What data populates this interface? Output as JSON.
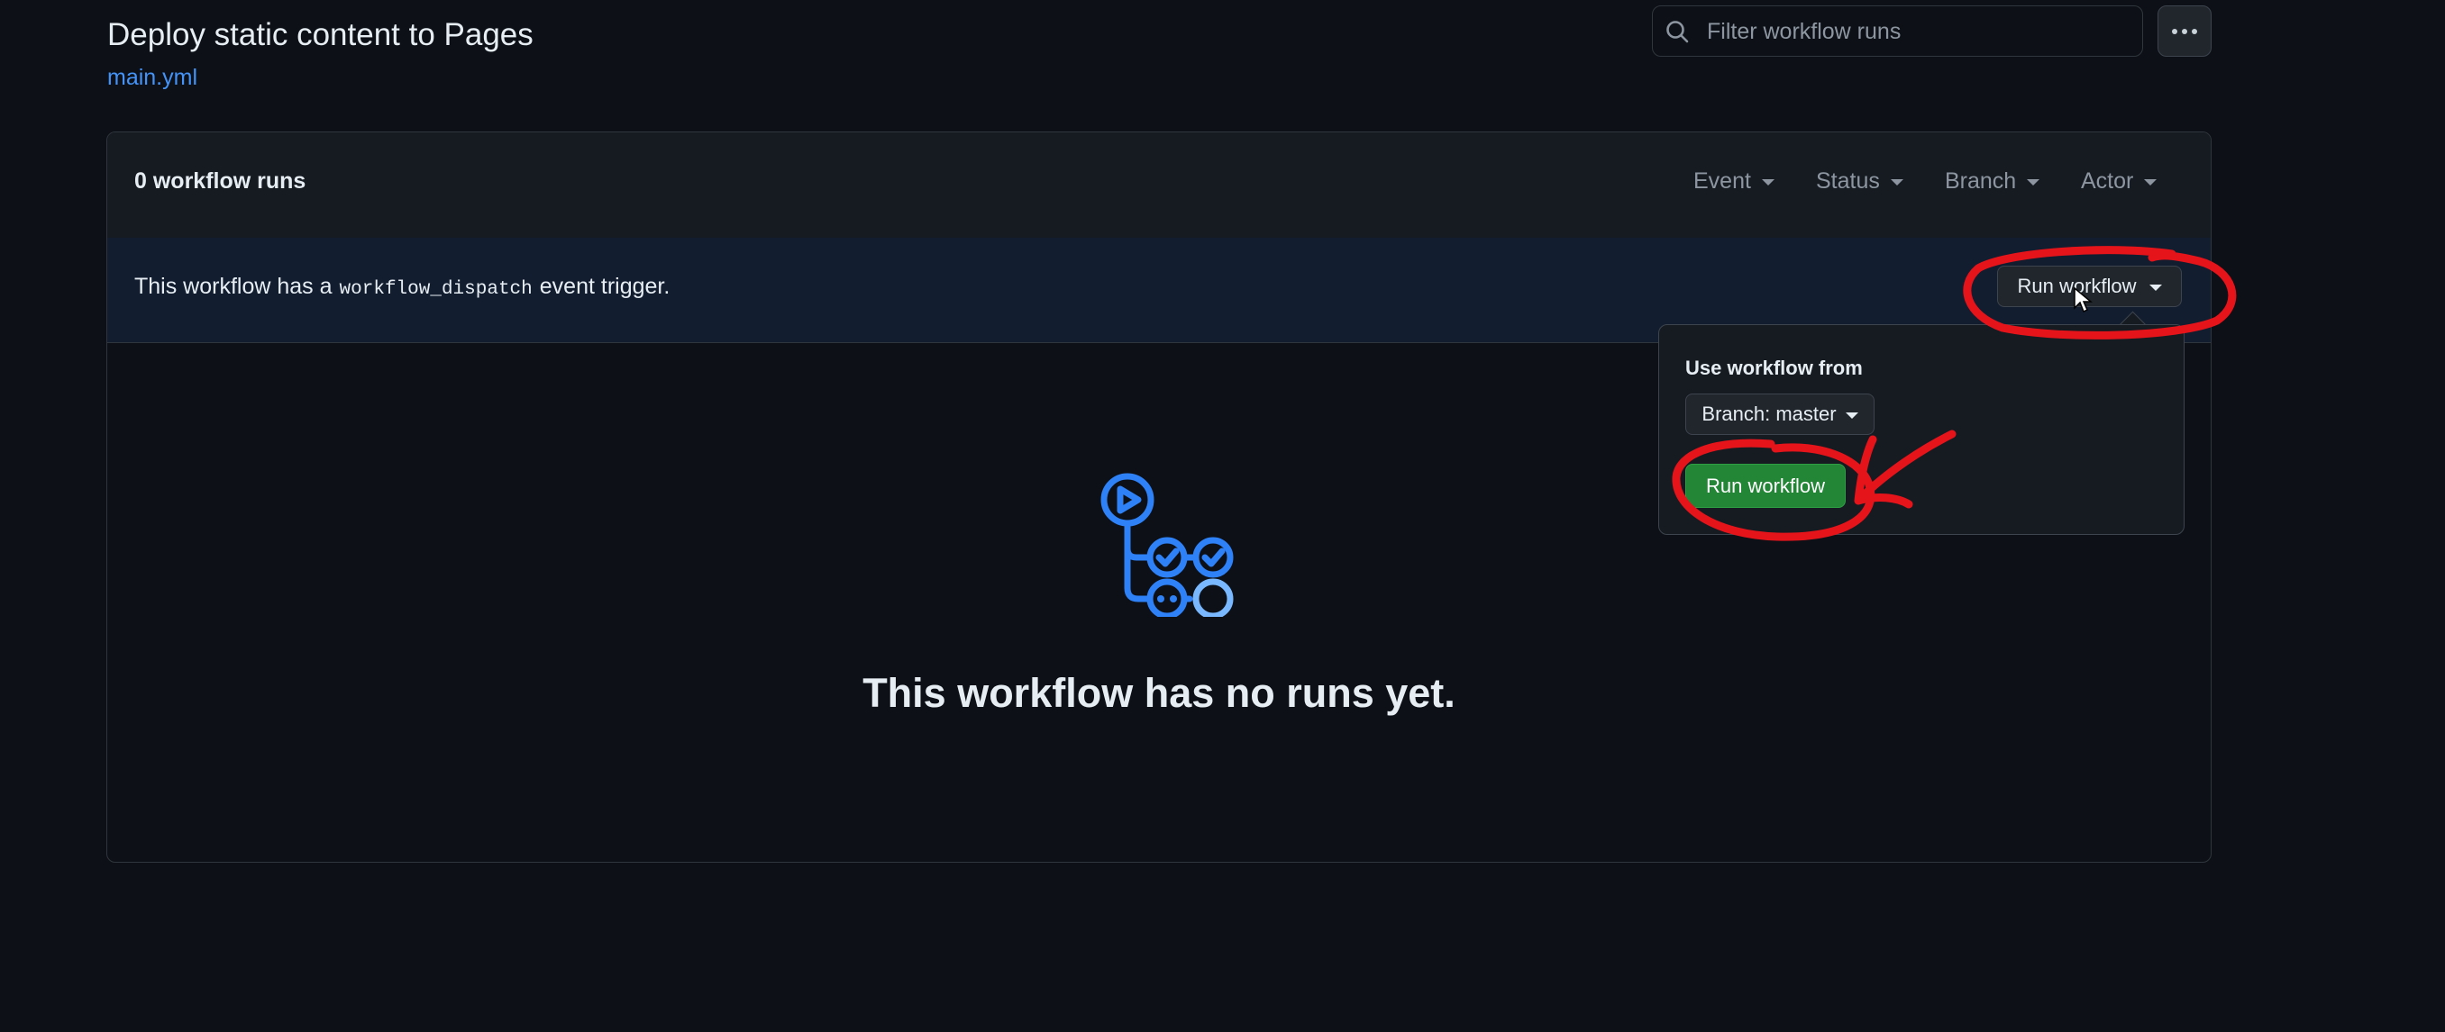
{
  "header": {
    "title": "Deploy static content to Pages",
    "file_link": "main.yml"
  },
  "search": {
    "placeholder": "Filter workflow runs"
  },
  "runs": {
    "count_label": "0 workflow runs",
    "filters": [
      "Event",
      "Status",
      "Branch",
      "Actor"
    ]
  },
  "dispatch": {
    "text_before": "This workflow has a",
    "code": "workflow_dispatch",
    "text_after": "event trigger.",
    "run_button_label": "Run workflow"
  },
  "dropdown": {
    "use_label": "Use workflow from",
    "branch_label": "Branch: master",
    "run_button_label": "Run workflow"
  },
  "empty_state": {
    "message": "This workflow has no runs yet.",
    "icon": "workflow-icon"
  },
  "colors": {
    "background": "#0d1117",
    "link": "#4493f8",
    "primary_button": "#238636",
    "annotation": "#e5141b"
  }
}
